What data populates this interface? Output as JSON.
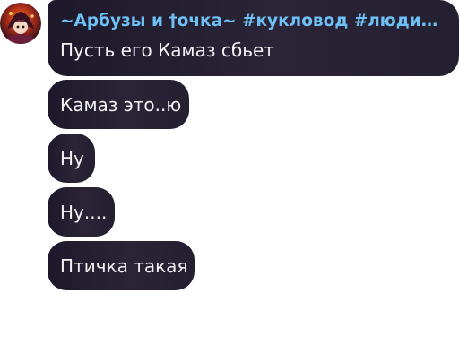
{
  "sender": {
    "name": "~Арбузы и †очка~ #кукловод #людипешки #а..."
  },
  "messages": [
    {
      "text": "Пусть его Камаз сбьет"
    },
    {
      "text": "Камаз это..ю"
    },
    {
      "text": "Ну"
    },
    {
      "text": "Ну...."
    },
    {
      "text": "Птичка такая"
    }
  ],
  "colors": {
    "bubble": "#241f31",
    "sender_name": "#6ec1f6",
    "message_text": "#f2f2f4",
    "background": "#ffffff"
  },
  "icons": {
    "avatar": "user-avatar"
  }
}
